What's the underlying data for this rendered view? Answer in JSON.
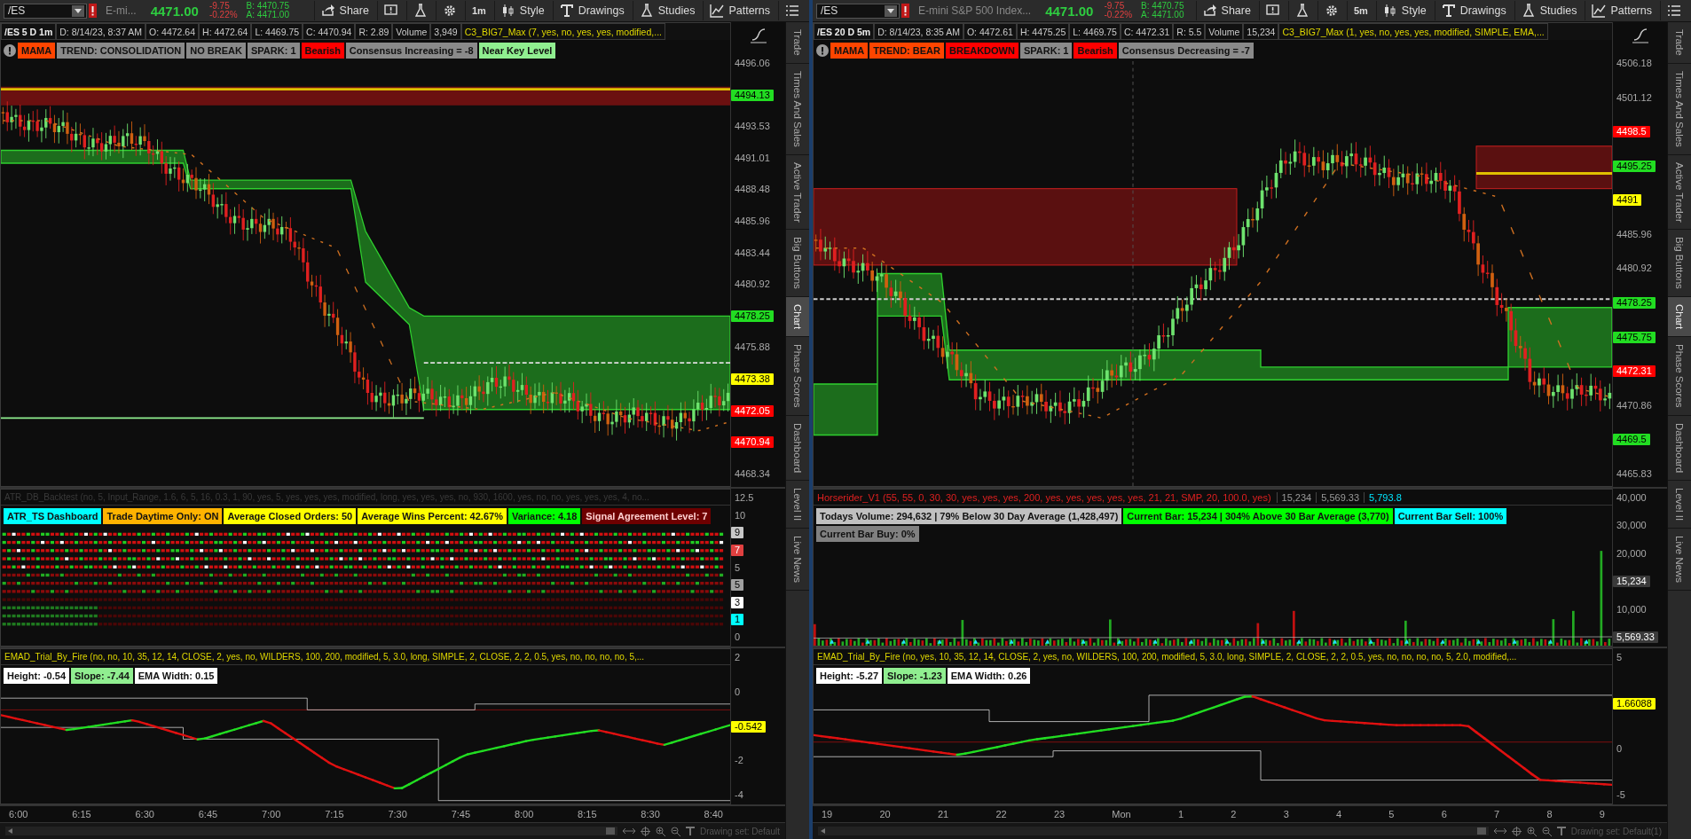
{
  "panels": [
    {
      "toolbar": {
        "symbol": "/ES",
        "description": "E-mi...",
        "last": "4471.00",
        "change": "-9.75",
        "change_pct": "-0.22%",
        "bid": "B: 4470.75",
        "ask": "A: 4471.00",
        "items": [
          {
            "kind": "share",
            "label": "Share"
          },
          {
            "kind": "alert"
          },
          {
            "kind": "flask"
          },
          {
            "kind": "gear"
          },
          {
            "kind": "text",
            "label": "1m"
          },
          {
            "kind": "style",
            "label": "Style"
          },
          {
            "kind": "drawings",
            "label": "Drawings"
          },
          {
            "kind": "studies",
            "label": "Studies"
          },
          {
            "kind": "patterns",
            "label": "Patterns"
          },
          {
            "kind": "menu"
          }
        ]
      },
      "header": {
        "cells": [
          "/ES 5 D 1m",
          "D: 8/14/23, 8:37 AM",
          "O: 4472.64",
          "H: 4472.64",
          "L: 4469.75",
          "C: 4470.94",
          "R: 2.89",
          "Volume",
          "3,949"
        ],
        "study": "C3_BIG7_Max (7, yes, no, yes, yes, modified,..."
      },
      "labels": [
        {
          "text": "MAMA",
          "color": "#ff4500"
        },
        {
          "text": "TREND: CONSOLIDATION",
          "color": "#8a8a8a"
        },
        {
          "text": "NO BREAK",
          "color": "#8a8a8a"
        },
        {
          "text": "SPARK: 1",
          "color": "#8a8a8a"
        },
        {
          "text": "Bearish",
          "color": "#ff0000"
        },
        {
          "text": "Consensus Increasing = -8",
          "color": "#8a8a8a"
        },
        {
          "text": "Near Key Level",
          "color": "#90ee90"
        }
      ],
      "price_axis": [
        {
          "kind": "plain",
          "text": "4496.06"
        },
        {
          "kind": "tag",
          "text": "4494.13",
          "color": "#22dd22"
        },
        {
          "kind": "plain",
          "text": "4493.53"
        },
        {
          "kind": "plain",
          "text": "4491.01"
        },
        {
          "kind": "plain",
          "text": "4488.48"
        },
        {
          "kind": "plain",
          "text": "4485.96"
        },
        {
          "kind": "plain",
          "text": "4483.44"
        },
        {
          "kind": "plain",
          "text": "4480.92"
        },
        {
          "kind": "tag",
          "text": "4478.25",
          "color": "#22dd22"
        },
        {
          "kind": "plain",
          "text": "4475.88"
        },
        {
          "kind": "tag",
          "text": "4473.38",
          "color": "#ffff00"
        },
        {
          "kind": "tag",
          "text": "4472.05",
          "color": "#ff0000"
        },
        {
          "kind": "tag",
          "text": "4470.94",
          "color": "#ff0000"
        },
        {
          "kind": "plain",
          "text": "4468.34"
        }
      ],
      "study": {
        "kind": "dashboard",
        "title": "ATR_DB_Backtest (no, 5, Input_Range, 1.6, 6, 5, 16, 0.3, 1, 90, yes, 5, yes, yes, yes, modified, long, yes, yes, yes, no, 930, 1600, yes, no, no, yes, yes, yes, 4, no...",
        "labels": [
          {
            "text": "ATR_TS Dashboard",
            "color": "#00ffff"
          },
          {
            "text": "Trade Daytime Only: ON",
            "color": "#ffb300"
          },
          {
            "text": "Average Closed Orders: 50",
            "color": "#ffff00"
          },
          {
            "text": "Average Wins Percent: 42.67%",
            "color": "#ffff00"
          },
          {
            "text": "Variance: 4.18",
            "color": "#00ff00"
          },
          {
            "text": "Signal Agreement Level: 7",
            "color": "#6e0000"
          }
        ],
        "axis": [
          {
            "kind": "plain",
            "text": "12.5"
          },
          {
            "kind": "plain",
            "text": "10"
          },
          {
            "kind": "tag",
            "text": "9",
            "color": "#c8c8c8"
          },
          {
            "kind": "tag",
            "text": "7",
            "color": "#e04040"
          },
          {
            "kind": "plain",
            "text": "5"
          },
          {
            "kind": "tag",
            "text": "5",
            "color": "#a0a0a0"
          },
          {
            "kind": "tag",
            "text": "3",
            "color": "#ffffff"
          },
          {
            "kind": "tag",
            "text": "1",
            "color": "#00ffff"
          },
          {
            "kind": "plain",
            "text": "0"
          }
        ]
      },
      "emad": {
        "title": "EMAD_Trial_By_Fire (no, no, 10, 35, 12, 14, CLOSE, 2, yes, no, WILDERS, 100, 200, modified, 5, 3.0, long, SIMPLE, 2, CLOSE, 2, 2, 0.5, yes, no, no, no, no, 5,...",
        "labels": [
          {
            "text": "Height: -0.54",
            "color": "#ffffff"
          },
          {
            "text": "Slope: -7.44",
            "color": "#90ee90"
          },
          {
            "text": "EMA Width: 0.15",
            "color": "#ffffff"
          }
        ],
        "axis": [
          {
            "kind": "plain",
            "text": "2"
          },
          {
            "kind": "plain",
            "text": "0"
          },
          {
            "kind": "tag",
            "text": "-0.542",
            "color": "#ffff00"
          },
          {
            "kind": "plain",
            "text": "-2"
          },
          {
            "kind": "plain",
            "text": "-4"
          }
        ]
      },
      "time_axis": [
        "6:00",
        "6:15",
        "6:30",
        "6:45",
        "7:00",
        "7:15",
        "7:30",
        "7:45",
        "8:00",
        "8:15",
        "8:30",
        "8:40"
      ],
      "drawing_set": "Drawing set: Default",
      "sidebar": [
        {
          "label": "Trade",
          "selected": false
        },
        {
          "label": "Times And Sales",
          "selected": false
        },
        {
          "label": "Active Trader",
          "selected": false
        },
        {
          "label": "Big Buttons",
          "selected": false
        },
        {
          "label": "Chart",
          "selected": true
        },
        {
          "label": "Phase Scores",
          "selected": false
        },
        {
          "label": "Dashboard",
          "selected": false
        },
        {
          "label": "Level II",
          "selected": false
        },
        {
          "label": "Live News",
          "selected": false
        }
      ]
    },
    {
      "toolbar": {
        "symbol": "/ES",
        "description": "E-mini S&P 500 Index...",
        "last": "4471.00",
        "change": "-9.75",
        "change_pct": "-0.22%",
        "bid": "B: 4470.75",
        "ask": "A: 4471.00",
        "items": [
          {
            "kind": "share",
            "label": "Share"
          },
          {
            "kind": "alert"
          },
          {
            "kind": "flask"
          },
          {
            "kind": "gear"
          },
          {
            "kind": "text",
            "label": "5m"
          },
          {
            "kind": "style",
            "label": "Style"
          },
          {
            "kind": "drawings",
            "label": "Drawings"
          },
          {
            "kind": "studies",
            "label": "Studies"
          },
          {
            "kind": "patterns",
            "label": "Patterns"
          },
          {
            "kind": "menu"
          }
        ]
      },
      "header": {
        "cells": [
          "/ES 20 D 5m",
          "D: 8/14/23, 8:35 AM",
          "O: 4472.61",
          "H: 4475.25",
          "L: 4469.75",
          "C: 4472.31",
          "R: 5.5",
          "Volume",
          "15,234"
        ],
        "study": "C3_BIG7_Max (1, yes, no, yes, yes, modified, SIMPLE, EMA,..."
      },
      "labels": [
        {
          "text": "MAMA",
          "color": "#ff4500"
        },
        {
          "text": "TREND: BEAR",
          "color": "#ff4500"
        },
        {
          "text": "BREAKDOWN",
          "color": "#ff0000"
        },
        {
          "text": "SPARK: 1",
          "color": "#8a8a8a"
        },
        {
          "text": "Bearish",
          "color": "#ff0000"
        },
        {
          "text": "Consensus Decreasing = -7",
          "color": "#8a8a8a"
        }
      ],
      "price_axis": [
        {
          "kind": "plain",
          "text": "4506.18"
        },
        {
          "kind": "plain",
          "text": "4501.12"
        },
        {
          "kind": "tag",
          "text": "4498.5",
          "color": "#ff0000"
        },
        {
          "kind": "tag",
          "text": "4495.25",
          "color": "#22dd22"
        },
        {
          "kind": "tag",
          "text": "4491",
          "color": "#ffff00"
        },
        {
          "kind": "plain",
          "text": "4485.96"
        },
        {
          "kind": "plain",
          "text": "4480.92"
        },
        {
          "kind": "tag",
          "text": "4478.25",
          "color": "#22dd22"
        },
        {
          "kind": "tag",
          "text": "4475.75",
          "color": "#22dd22"
        },
        {
          "kind": "tag",
          "text": "4472.31",
          "color": "#ff0000"
        },
        {
          "kind": "plain",
          "text": "4470.86"
        },
        {
          "kind": "tag",
          "text": "4469.5",
          "color": "#22dd22"
        },
        {
          "kind": "plain",
          "text": "4465.83"
        }
      ],
      "study": {
        "kind": "volume",
        "title": "Horserider_V1 (55, 55, 0, 30, 30, yes, yes, yes, 200, yes, yes, yes, yes, yes, 21, 21, SMP, 20, 100.0, yes)",
        "values": [
          {
            "text": "15,234",
            "color": "#9a9a9a"
          },
          {
            "text": "5,569.33",
            "color": "#9a9a9a"
          },
          {
            "text": "5,793.8",
            "color": "#00e5ff"
          }
        ],
        "labels": [
          {
            "text": "Todays Volume: 294,632 | 79% Below 30 Day Average (1,428,497)",
            "color": "#c0c0c0"
          },
          {
            "text": "Current Bar: 15,234 | 304% Above 30 Bar Average (3,770)",
            "color": "#00ff00"
          },
          {
            "text": "Current Bar Sell: 100%",
            "color": "#00ffff"
          },
          {
            "text": "Current Bar Buy: 0%",
            "color": "#808080"
          }
        ],
        "axis": [
          {
            "kind": "plain",
            "text": "40,000"
          },
          {
            "kind": "plain",
            "text": "30,000"
          },
          {
            "kind": "plain",
            "text": "20,000"
          },
          {
            "kind": "tag",
            "text": "15,234",
            "color": "#3a3a3a"
          },
          {
            "kind": "plain",
            "text": "10,000"
          },
          {
            "kind": "tag",
            "text": "5,569.33",
            "color": "#3a3a3a"
          }
        ]
      },
      "emad": {
        "title": "EMAD_Trial_By_Fire (no, yes, 10, 35, 12, 14, CLOSE, 2, yes, no, WILDERS, 100, 200, modified, 5, 3.0, long, SIMPLE, 2, CLOSE, 2, 2, 0.5, yes, no, no, no, no, 5, 2.0, modified,...",
        "labels": [
          {
            "text": "Height: -5.27",
            "color": "#ffffff"
          },
          {
            "text": "Slope: -1.23",
            "color": "#90ee90"
          },
          {
            "text": "EMA Width: 0.26",
            "color": "#ffffff"
          }
        ],
        "axis": [
          {
            "kind": "plain",
            "text": "5"
          },
          {
            "kind": "tag",
            "text": "1.66088",
            "color": "#ffff00"
          },
          {
            "kind": "plain",
            "text": "0"
          },
          {
            "kind": "plain",
            "text": "-5"
          }
        ]
      },
      "time_axis": [
        "19",
        "20",
        "21",
        "22",
        "23",
        "Mon",
        "1",
        "2",
        "3",
        "4",
        "5",
        "6",
        "7",
        "8",
        "9"
      ],
      "drawing_set": "Drawing set: Default(1)",
      "sidebar": [
        {
          "label": "Trade",
          "selected": false
        },
        {
          "label": "Times And Sales",
          "selected": false
        },
        {
          "label": "Active Trader",
          "selected": false
        },
        {
          "label": "Big Buttons",
          "selected": false
        },
        {
          "label": "Chart",
          "selected": true
        },
        {
          "label": "Phase Scores",
          "selected": false
        },
        {
          "label": "Dashboard",
          "selected": false
        },
        {
          "label": "Level II",
          "selected": false
        },
        {
          "label": "Live News",
          "selected": false
        }
      ]
    }
  ]
}
